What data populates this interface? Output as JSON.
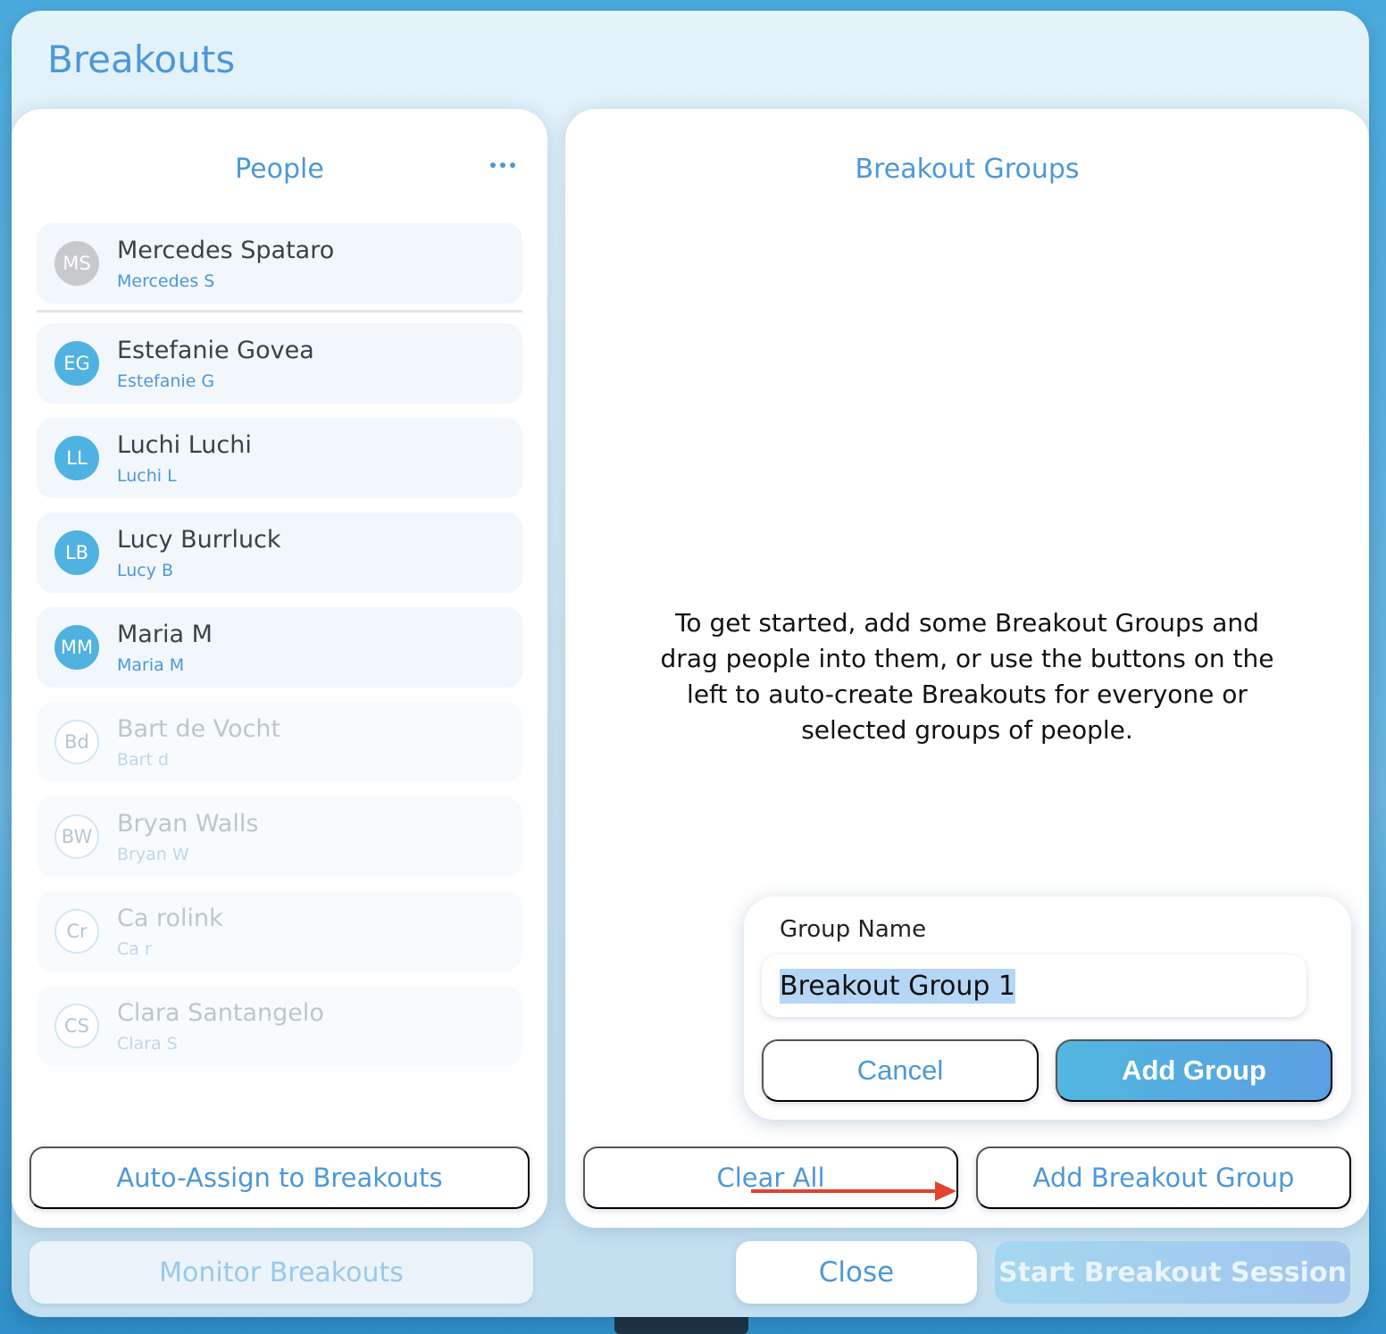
{
  "modal": {
    "title": "Breakouts"
  },
  "people_panel": {
    "title": "People",
    "more_icon": "ellipsis-icon",
    "people": [
      {
        "initials": "MS",
        "name": "Mercedes Spataro",
        "short": "Mercedes S",
        "state": "host"
      },
      {
        "initials": "EG",
        "name": "Estefanie Govea",
        "short": "Estefanie G",
        "state": "active"
      },
      {
        "initials": "LL",
        "name": "Luchi Luchi",
        "short": "Luchi L",
        "state": "active"
      },
      {
        "initials": "LB",
        "name": "Lucy Burrluck",
        "short": "Lucy B",
        "state": "active"
      },
      {
        "initials": "MM",
        "name": "Maria M",
        "short": "Maria M",
        "state": "active"
      },
      {
        "initials": "Bd",
        "name": "Bart de Vocht",
        "short": "Bart d",
        "state": "inactive"
      },
      {
        "initials": "BW",
        "name": "Bryan Walls",
        "short": "Bryan W",
        "state": "inactive"
      },
      {
        "initials": "Cr",
        "name": "Ca rolink",
        "short": "Ca r",
        "state": "inactive"
      },
      {
        "initials": "CS",
        "name": "Clara Santangelo",
        "short": "Clara S",
        "state": "inactive"
      }
    ],
    "auto_assign_label": "Auto-Assign to Breakouts"
  },
  "groups_panel": {
    "title": "Breakout Groups",
    "empty_message": "To get started, add some Breakout Groups and drag people into them, or use the buttons on the left to auto-create Breakouts for everyone or selected groups of people.",
    "clear_all_label": "Clear All",
    "add_breakout_group_label": "Add Breakout Group"
  },
  "popover": {
    "label": "Group Name",
    "input_value": "Breakout Group 1",
    "cancel_label": "Cancel",
    "add_label": "Add Group"
  },
  "footer": {
    "monitor_label": "Monitor Breakouts",
    "close_label": "Close",
    "start_label": "Start Breakout Session"
  },
  "colors": {
    "accent": "#4d97d8",
    "avatar_active": "#4fb2e1",
    "avatar_host": "#c7c9cc",
    "annotation_arrow": "#e0432f"
  }
}
